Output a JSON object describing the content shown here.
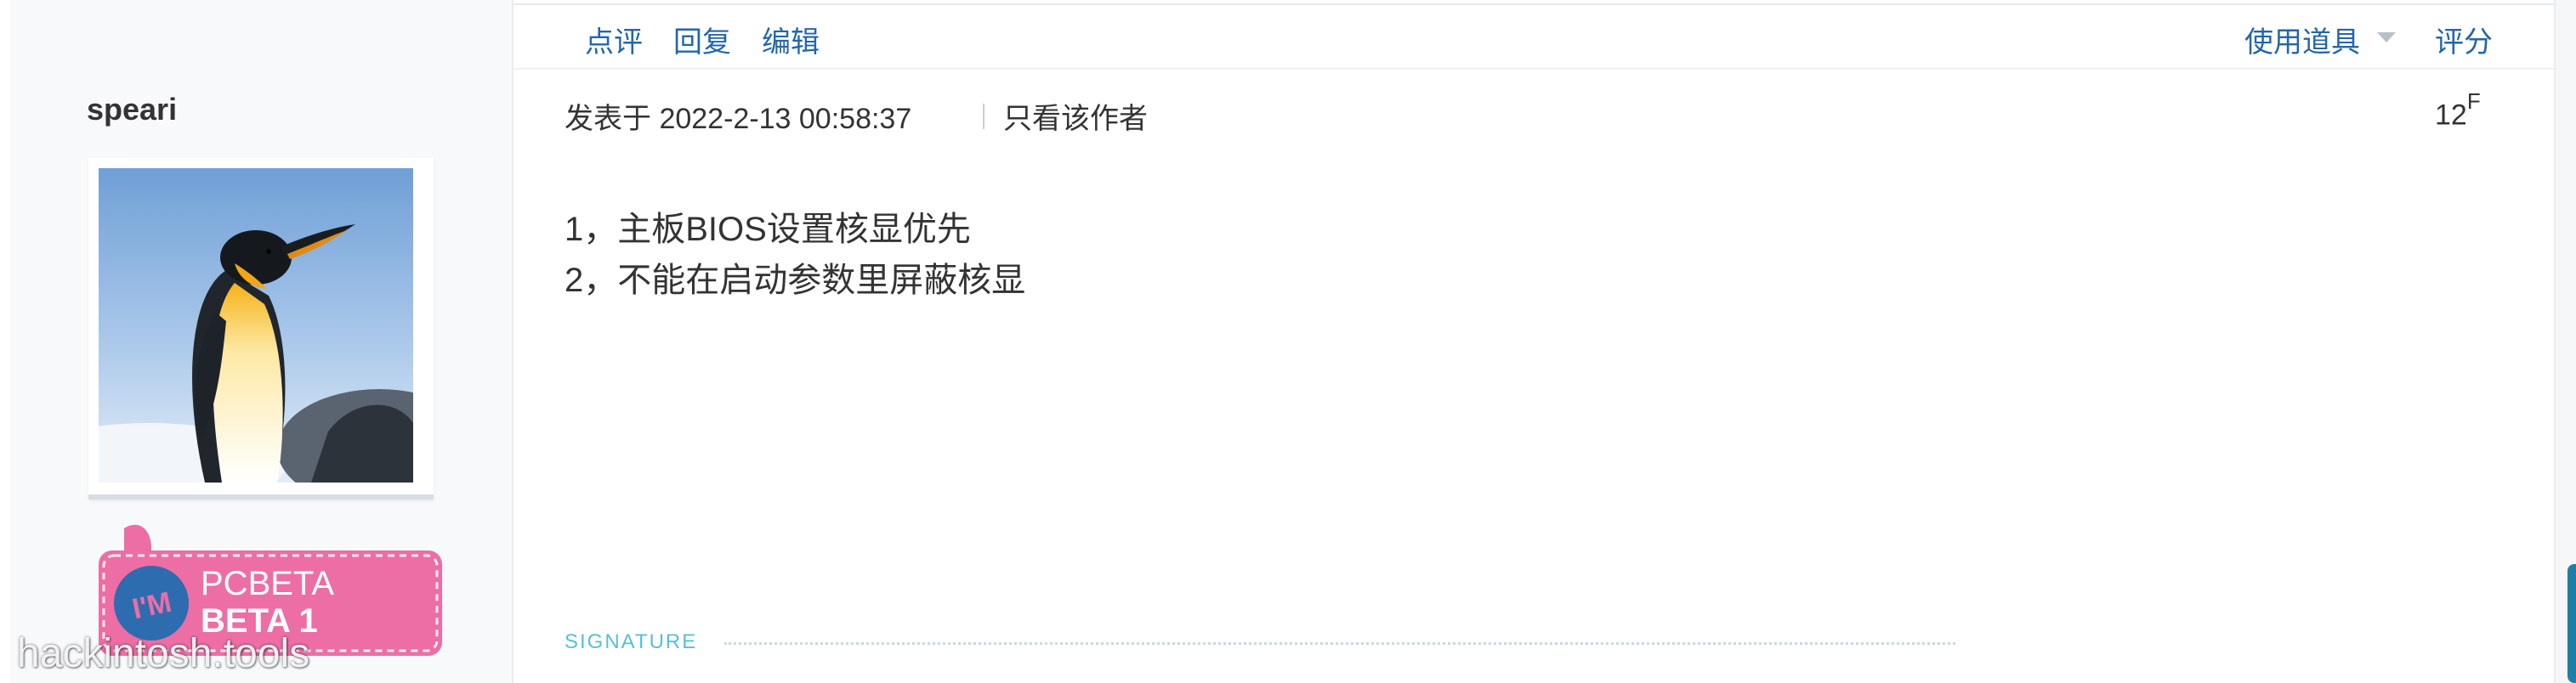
{
  "author": {
    "name": "speari",
    "badge_line1": "PCBETA",
    "badge_line2": "BETA 1",
    "badge_prefix": "I'M"
  },
  "watermark": "hackintosh.tools",
  "actions": {
    "comment": "点评",
    "reply": "回复",
    "edit": "编辑",
    "tools": "使用道具",
    "rate": "评分"
  },
  "post": {
    "posted_at": "发表于 2022-2-13 00:58:37",
    "only_author": "只看该作者",
    "floor_number": "12",
    "floor_suffix": "F",
    "lines": [
      "1，主板BIOS设置核显优先",
      "2，不能在启动参数里屏蔽核显"
    ]
  },
  "signature_label": "SIGNATURE",
  "colors": {
    "link": "#2366a8",
    "badge_pink": "#ec6ea5",
    "signature": "#5bbfd2"
  }
}
